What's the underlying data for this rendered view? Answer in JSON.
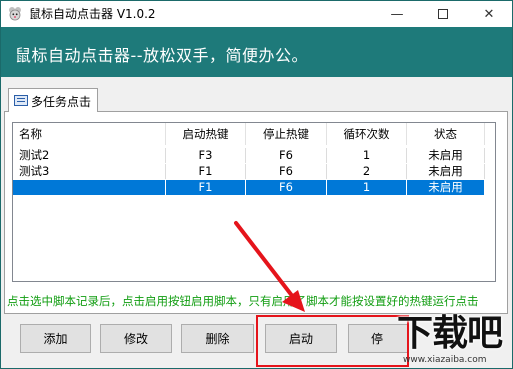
{
  "window": {
    "title": "鼠标自动点击器 V1.0.2",
    "controls": {
      "minimize": "—",
      "close": "✕"
    }
  },
  "banner": {
    "text": "鼠标自动点击器--放松双手，简便办公。"
  },
  "tab": {
    "label": "多任务点击"
  },
  "table": {
    "columns": [
      "名称",
      "启动热键",
      "停止热键",
      "循环次数",
      "状态"
    ],
    "rows": [
      {
        "name": "测试2",
        "start_key": "F3",
        "stop_key": "F6",
        "loops": "1",
        "status": "未启用",
        "selected": false
      },
      {
        "name": "测试3",
        "start_key": "F1",
        "stop_key": "F6",
        "loops": "2",
        "status": "未启用",
        "selected": false
      },
      {
        "name": "",
        "start_key": "F1",
        "stop_key": "F6",
        "loops": "1",
        "status": "未启用",
        "selected": true
      }
    ]
  },
  "hint": "点击选中脚本记录后，点击启用按钮启用脚本，只有启用了脚本才能按设置好的热键运行点击",
  "buttons": {
    "add": "添加",
    "edit": "修改",
    "delete": "删除",
    "start": "启动",
    "stop": "停"
  },
  "watermark": {
    "brand": "下载吧",
    "url": "www.xiazaiba.com"
  },
  "colors": {
    "banner": "#1e7a7a",
    "selection": "#0078d7",
    "hint": "#119d11",
    "annotation": "#e5141b"
  }
}
